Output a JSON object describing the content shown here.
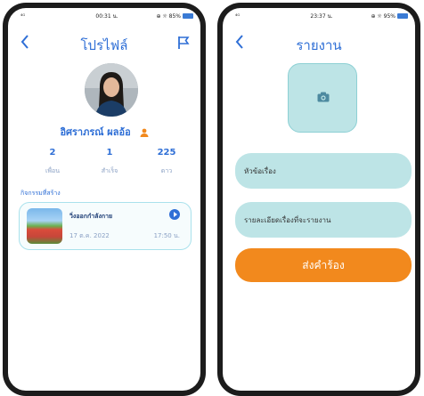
{
  "colors": {
    "accent": "#2f6fd6",
    "field_bg": "#bde4e6",
    "submit": "#f2891d",
    "badge": "#f2891d"
  },
  "profile_screen": {
    "status": {
      "signal": "⁴ᴳ",
      "time": "00:31 น.",
      "battery": "⊕ ☼ 85%"
    },
    "back_icon": "chevron-left-icon",
    "title": "โปรไฟล์",
    "flag_icon": "flag-icon",
    "user_name": "อิศราภรณ์ ผลอ้อ",
    "person_icon": "person-icon",
    "stats": [
      {
        "value": "2",
        "label": "เพื่อน"
      },
      {
        "value": "1",
        "label": "สำเร็จ"
      },
      {
        "value": "225",
        "label": "ดาว"
      }
    ],
    "section_title": "กิจกรรมที่สร้าง",
    "activity": {
      "title": "วิ่งออกกำลังกาย",
      "date": "17 ต.ค. 2022",
      "time": "17:50 น.",
      "action_icon": "play-icon"
    }
  },
  "report_screen": {
    "status": {
      "signal": "⁴ᴳ",
      "time": "23:37 น.",
      "battery": "⊕ ☼ 95%"
    },
    "back_icon": "chevron-left-icon",
    "title": "รายงาน",
    "camera_icon": "camera-icon",
    "subject_placeholder": "หัวข้อเรื่อง",
    "detail_placeholder": "รายละเอียดเรื่องที่จะรายงาน",
    "submit_label": "ส่งคำร้อง"
  }
}
